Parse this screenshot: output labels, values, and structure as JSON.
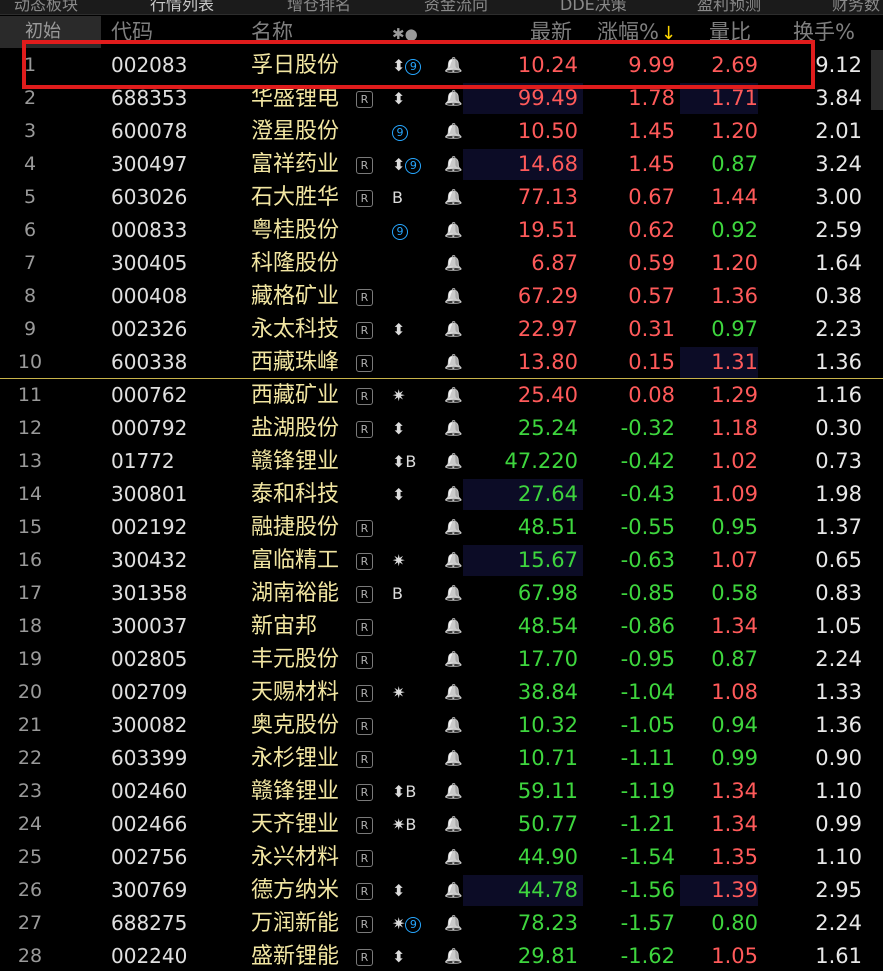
{
  "tabs": [
    {
      "label": "动态板块",
      "active": false
    },
    {
      "label": "行情列表",
      "active": true
    },
    {
      "label": "增仓排名",
      "active": false
    },
    {
      "label": "资金流向",
      "active": false
    },
    {
      "label": "DDE决策",
      "active": false
    },
    {
      "label": "盈利预测",
      "active": false
    },
    {
      "label": "财务数",
      "active": false
    }
  ],
  "header": {
    "initial": "初始",
    "code": "代码",
    "name": "名称",
    "flags": "✱●",
    "price": "最新",
    "change": "涨幅%",
    "sort_arrow": "↓",
    "ratio": "量比",
    "turnover": "换手%"
  },
  "colors": {
    "up": "#ff5a5a",
    "down": "#3ed63e",
    "name": "#f2e6a2",
    "highlight": "#e01c1c"
  },
  "rows": [
    {
      "idx": "1",
      "code": "002083",
      "name": "孚日股份",
      "r": false,
      "flags": "⬍⑨",
      "price": "10.24",
      "change": "9.99",
      "ratio": "2.69",
      "turnover": "9.12",
      "pc": "red",
      "cc": "red",
      "rc": "red"
    },
    {
      "idx": "2",
      "code": "688353",
      "name": "华盛锂电",
      "r": true,
      "flags": "⬍",
      "price": "99.49",
      "change": "1.78",
      "ratio": "1.71",
      "turnover": "3.84",
      "pc": "red",
      "cc": "red",
      "rc": "red",
      "bg": [
        "price",
        "ratio"
      ]
    },
    {
      "idx": "3",
      "code": "600078",
      "name": "澄星股份",
      "r": false,
      "flags": "⑨",
      "price": "10.50",
      "change": "1.45",
      "ratio": "1.20",
      "turnover": "2.01",
      "pc": "red",
      "cc": "red",
      "rc": "red"
    },
    {
      "idx": "4",
      "code": "300497",
      "name": "富祥药业",
      "r": true,
      "flags": "⬍⑨",
      "price": "14.68",
      "change": "1.45",
      "ratio": "0.87",
      "turnover": "3.24",
      "pc": "red",
      "cc": "red",
      "rc": "green",
      "bg": [
        "price"
      ]
    },
    {
      "idx": "5",
      "code": "603026",
      "name": "石大胜华",
      "r": true,
      "flags": "B",
      "price": "77.13",
      "change": "0.67",
      "ratio": "1.44",
      "turnover": "3.00",
      "pc": "red",
      "cc": "red",
      "rc": "red"
    },
    {
      "idx": "6",
      "code": "000833",
      "name": "粤桂股份",
      "r": false,
      "flags": "⑨",
      "price": "19.51",
      "change": "0.62",
      "ratio": "0.92",
      "turnover": "2.59",
      "pc": "red",
      "cc": "red",
      "rc": "green"
    },
    {
      "idx": "7",
      "code": "300405",
      "name": "科隆股份",
      "r": false,
      "flags": "",
      "price": "6.87",
      "change": "0.59",
      "ratio": "1.20",
      "turnover": "1.64",
      "pc": "red",
      "cc": "red",
      "rc": "red"
    },
    {
      "idx": "8",
      "code": "000408",
      "name": "藏格矿业",
      "r": true,
      "flags": "",
      "price": "67.29",
      "change": "0.57",
      "ratio": "1.36",
      "turnover": "0.38",
      "pc": "red",
      "cc": "red",
      "rc": "red"
    },
    {
      "idx": "9",
      "code": "002326",
      "name": "永太科技",
      "r": true,
      "flags": "⬍",
      "price": "22.97",
      "change": "0.31",
      "ratio": "0.97",
      "turnover": "2.23",
      "pc": "red",
      "cc": "red",
      "rc": "green"
    },
    {
      "idx": "10",
      "code": "600338",
      "name": "西藏珠峰",
      "r": true,
      "flags": "",
      "price": "13.80",
      "change": "0.15",
      "ratio": "1.31",
      "turnover": "1.36",
      "pc": "red",
      "cc": "red",
      "rc": "red",
      "bg": [
        "ratio"
      ]
    },
    {
      "idx": "11",
      "code": "000762",
      "name": "西藏矿业",
      "r": true,
      "flags": "✷",
      "price": "25.40",
      "change": "0.08",
      "ratio": "1.29",
      "turnover": "1.16",
      "pc": "red",
      "cc": "red",
      "rc": "red"
    },
    {
      "idx": "12",
      "code": "000792",
      "name": "盐湖股份",
      "r": true,
      "flags": "⬍",
      "price": "25.24",
      "change": "-0.32",
      "ratio": "1.18",
      "turnover": "0.30",
      "pc": "green",
      "cc": "green",
      "rc": "red"
    },
    {
      "idx": "13",
      "code": "01772",
      "name": "赣锋锂业",
      "r": false,
      "flags": "⬍B",
      "price": "47.220",
      "change": "-0.42",
      "ratio": "1.02",
      "turnover": "0.73",
      "pc": "green",
      "cc": "green",
      "rc": "red"
    },
    {
      "idx": "14",
      "code": "300801",
      "name": "泰和科技",
      "r": false,
      "flags": "⬍",
      "price": "27.64",
      "change": "-0.43",
      "ratio": "1.09",
      "turnover": "1.98",
      "pc": "green",
      "cc": "green",
      "rc": "red",
      "bg": [
        "price"
      ]
    },
    {
      "idx": "15",
      "code": "002192",
      "name": "融捷股份",
      "r": true,
      "flags": "",
      "price": "48.51",
      "change": "-0.55",
      "ratio": "0.95",
      "turnover": "1.37",
      "pc": "green",
      "cc": "green",
      "rc": "green"
    },
    {
      "idx": "16",
      "code": "300432",
      "name": "富临精工",
      "r": true,
      "flags": "✷",
      "price": "15.67",
      "change": "-0.63",
      "ratio": "1.07",
      "turnover": "0.65",
      "pc": "green",
      "cc": "green",
      "rc": "red",
      "bg": [
        "price"
      ]
    },
    {
      "idx": "17",
      "code": "301358",
      "name": "湖南裕能",
      "r": true,
      "flags": "B",
      "price": "67.98",
      "change": "-0.85",
      "ratio": "0.58",
      "turnover": "0.83",
      "pc": "green",
      "cc": "green",
      "rc": "green"
    },
    {
      "idx": "18",
      "code": "300037",
      "name": "新宙邦",
      "r": true,
      "flags": "",
      "price": "48.54",
      "change": "-0.86",
      "ratio": "1.34",
      "turnover": "1.05",
      "pc": "green",
      "cc": "green",
      "rc": "red"
    },
    {
      "idx": "19",
      "code": "002805",
      "name": "丰元股份",
      "r": true,
      "flags": "",
      "price": "17.70",
      "change": "-0.95",
      "ratio": "0.87",
      "turnover": "2.24",
      "pc": "green",
      "cc": "green",
      "rc": "green"
    },
    {
      "idx": "20",
      "code": "002709",
      "name": "天赐材料",
      "r": true,
      "flags": "✷",
      "price": "38.84",
      "change": "-1.04",
      "ratio": "1.08",
      "turnover": "1.33",
      "pc": "green",
      "cc": "green",
      "rc": "red"
    },
    {
      "idx": "21",
      "code": "300082",
      "name": "奥克股份",
      "r": true,
      "flags": "",
      "price": "10.32",
      "change": "-1.05",
      "ratio": "0.94",
      "turnover": "1.36",
      "pc": "green",
      "cc": "green",
      "rc": "green"
    },
    {
      "idx": "22",
      "code": "603399",
      "name": "永杉锂业",
      "r": true,
      "flags": "",
      "price": "10.71",
      "change": "-1.11",
      "ratio": "0.99",
      "turnover": "0.90",
      "pc": "green",
      "cc": "green",
      "rc": "green"
    },
    {
      "idx": "23",
      "code": "002460",
      "name": "赣锋锂业",
      "r": true,
      "flags": "⬍B",
      "price": "59.11",
      "change": "-1.19",
      "ratio": "1.34",
      "turnover": "1.10",
      "pc": "green",
      "cc": "green",
      "rc": "red"
    },
    {
      "idx": "24",
      "code": "002466",
      "name": "天齐锂业",
      "r": true,
      "flags": "✷B",
      "price": "50.77",
      "change": "-1.21",
      "ratio": "1.34",
      "turnover": "0.99",
      "pc": "green",
      "cc": "green",
      "rc": "red"
    },
    {
      "idx": "25",
      "code": "002756",
      "name": "永兴材料",
      "r": true,
      "flags": "",
      "price": "44.90",
      "change": "-1.54",
      "ratio": "1.35",
      "turnover": "1.10",
      "pc": "green",
      "cc": "green",
      "rc": "red"
    },
    {
      "idx": "26",
      "code": "300769",
      "name": "德方纳米",
      "r": true,
      "flags": "⬍",
      "price": "44.78",
      "change": "-1.56",
      "ratio": "1.39",
      "turnover": "2.95",
      "pc": "green",
      "cc": "green",
      "rc": "red",
      "bg": [
        "price",
        "ratio"
      ]
    },
    {
      "idx": "27",
      "code": "688275",
      "name": "万润新能",
      "r": true,
      "flags": "✷⑨",
      "price": "78.23",
      "change": "-1.57",
      "ratio": "0.80",
      "turnover": "2.24",
      "pc": "green",
      "cc": "green",
      "rc": "green"
    },
    {
      "idx": "28",
      "code": "002240",
      "name": "盛新锂能",
      "r": true,
      "flags": "⬍",
      "price": "29.81",
      "change": "-1.62",
      "ratio": "1.05",
      "turnover": "1.61",
      "pc": "green",
      "cc": "green",
      "rc": "red"
    }
  ]
}
